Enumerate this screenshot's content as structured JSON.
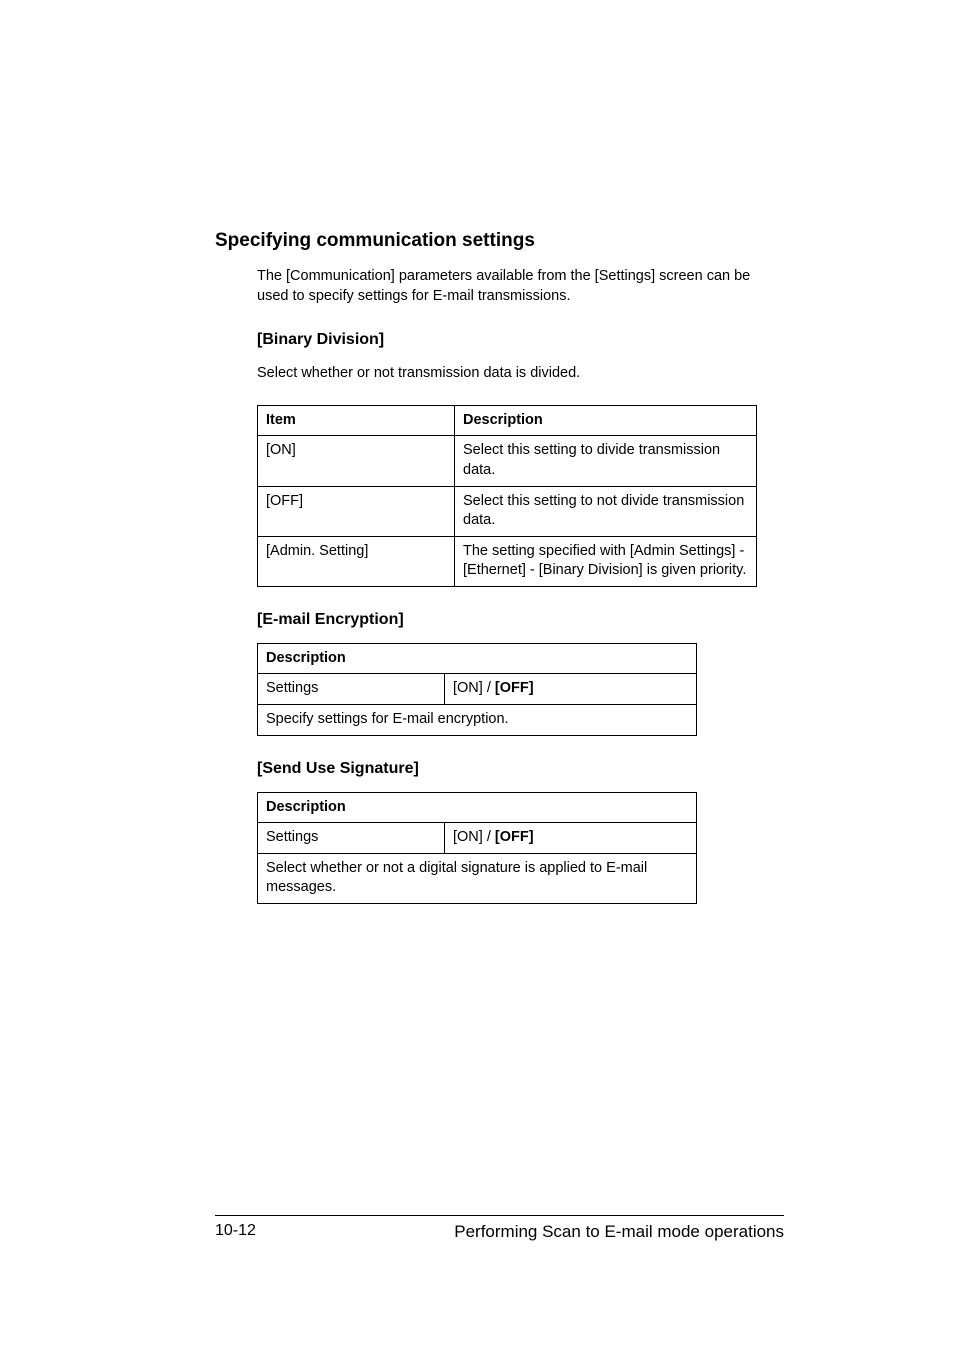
{
  "section": {
    "heading": "Specifying communication settings",
    "intro": "The [Communication] parameters available from the [Settings] screen can be used to specify settings for E-mail transmissions."
  },
  "binary": {
    "heading": "[Binary Division]",
    "intro": "Select whether or not transmission data is divided.",
    "header_item": "Item",
    "header_desc": "Description",
    "rows": [
      {
        "item": "[ON]",
        "desc": "Select this setting to divide transmission data."
      },
      {
        "item": "[OFF]",
        "desc": "Select this setting to not divide transmission data."
      },
      {
        "item": "[Admin. Setting]",
        "desc": "The setting specified with [Admin Settings] - [Ethernet] - [Binary Division] is given priority."
      }
    ]
  },
  "encryption": {
    "heading": "[E-mail Encryption]",
    "header_desc": "Description",
    "settings_label": "Settings",
    "settings_value_plain": "[ON] / ",
    "settings_value_bold": "[OFF]",
    "note": "Specify settings for E-mail encryption."
  },
  "signature": {
    "heading": "[Send Use Signature]",
    "header_desc": "Description",
    "settings_label": "Settings",
    "settings_value_plain": "[ON] / ",
    "settings_value_bold": "[OFF]",
    "note": "Select whether or not a digital signature is applied to E-mail messages."
  },
  "footer": {
    "page": "10-12",
    "title": "Performing Scan to E-mail mode operations"
  }
}
